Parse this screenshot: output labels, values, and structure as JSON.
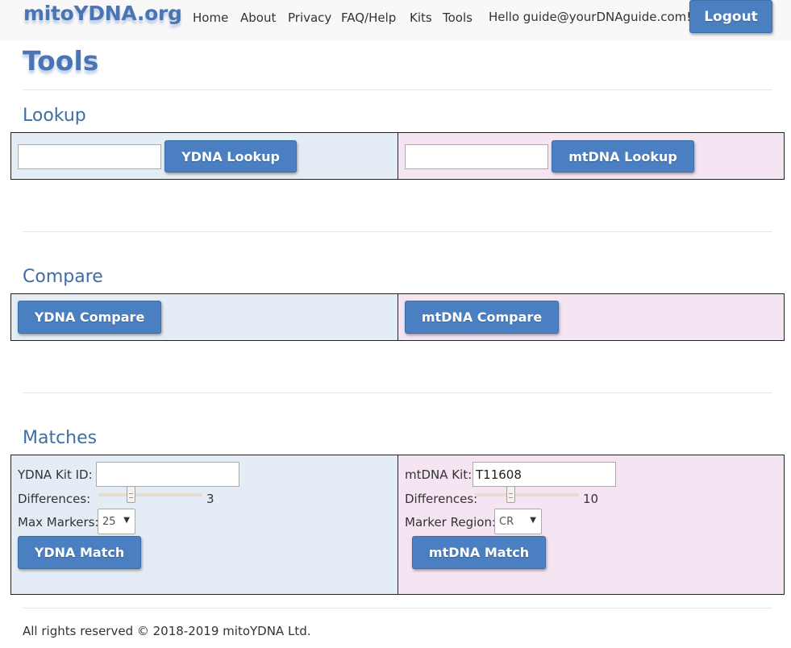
{
  "header": {
    "brand": "mitoYDNA.org",
    "nav": [
      "Home",
      "About",
      "Privacy",
      "FAQ/Help",
      "Kits",
      "Tools"
    ],
    "greeting": "Hello guide@yourDNAguide.com!",
    "logout_label": "Logout"
  },
  "page": {
    "title": "Tools"
  },
  "lookup": {
    "title": "Lookup",
    "ydna_input_value": "",
    "ydna_button": "YDNA Lookup",
    "mtdna_input_value": "",
    "mtdna_button": "mtDNA Lookup"
  },
  "compare": {
    "title": "Compare",
    "ydna_button": "YDNA Compare",
    "mtdna_button": "mtDNA Compare"
  },
  "matches": {
    "title": "Matches",
    "ydna": {
      "kit_label": "YDNA Kit ID:",
      "kit_value": "",
      "differences_label": "Differences:",
      "differences_value": "3",
      "max_markers_label": "Max Markers:",
      "max_markers_value": "25",
      "button": "YDNA Match"
    },
    "mtdna": {
      "kit_label": "mtDNA Kit:",
      "kit_value": "T11608",
      "differences_label": "Differences:",
      "differences_value": "10",
      "region_label": "Marker Region:",
      "region_value": "CR",
      "button": "mtDNA Match"
    }
  },
  "footer": {
    "text": "All rights reserved © 2018-2019 mitoYDNA Ltd."
  },
  "colors": {
    "brand": "#4a74b3",
    "button": "#4a7fc1",
    "ydna_panel": "#e4ecf5",
    "mtdna_panel": "#f5e5f3"
  }
}
